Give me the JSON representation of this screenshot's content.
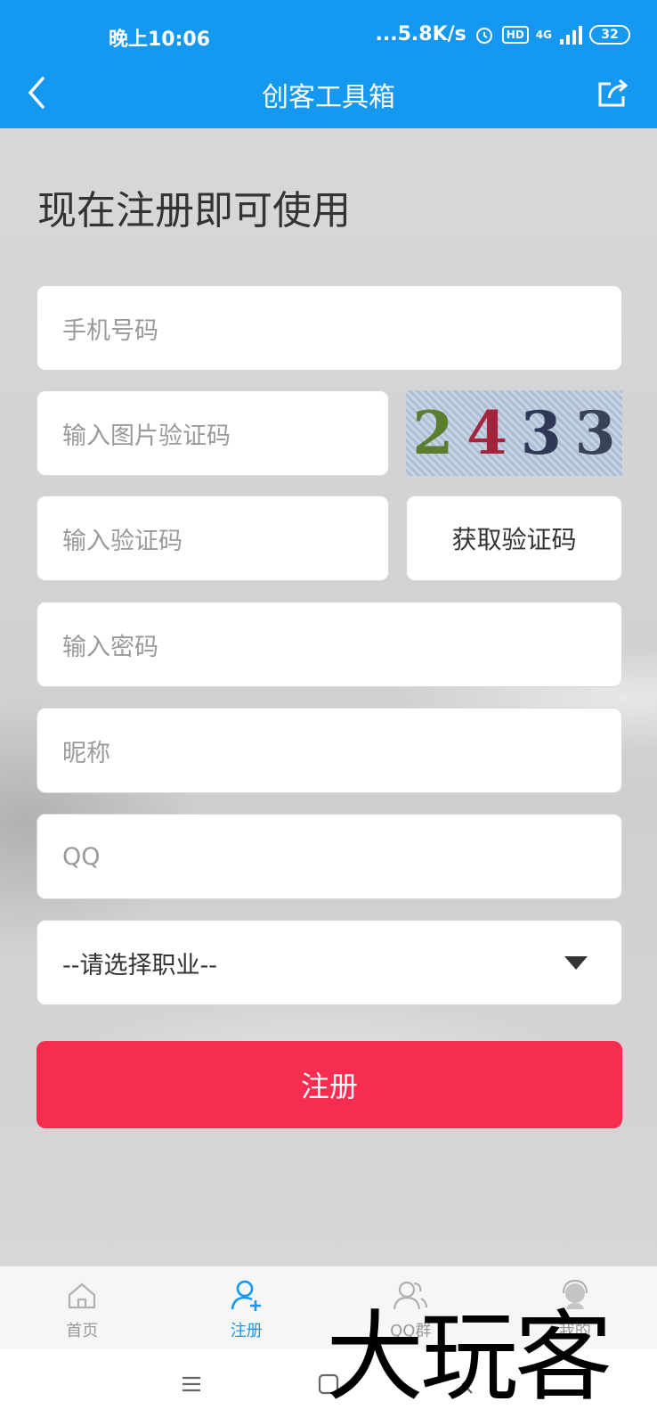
{
  "status_bar": {
    "time": "晚上10:06",
    "network_speed": "...5.8K/s",
    "hd_label": "HD",
    "network_label": "4G",
    "battery": "32"
  },
  "header": {
    "title": "创客工具箱",
    "back_icon": "chevron-left-icon",
    "share_icon": "share-icon",
    "bg_color": "#1598f0"
  },
  "form": {
    "heading": "现在注册即可使用",
    "phone_placeholder": "手机号码",
    "captcha_placeholder": "输入图片验证码",
    "captcha_digits": [
      "2",
      "4",
      "3",
      "3"
    ],
    "captcha_colors": [
      "#5b7d2e",
      "#a4243b",
      "#2e3a55",
      "#3a4258"
    ],
    "code_placeholder": "输入验证码",
    "get_code_label": "获取验证码",
    "password_placeholder": "输入密码",
    "nickname_placeholder": "昵称",
    "qq_placeholder": "QQ",
    "occupation_select": "--请选择职业--",
    "submit_label": "注册",
    "submit_color": "#f62d50"
  },
  "tabbar": {
    "items": [
      {
        "label": "首页",
        "icon": "home-icon",
        "active": false
      },
      {
        "label": "注册",
        "icon": "add-user-icon",
        "active": true
      },
      {
        "label": "QQ群",
        "icon": "group-icon",
        "active": false
      },
      {
        "label": "我的",
        "icon": "support-agent-icon",
        "active": false
      }
    ]
  },
  "watermark": "大玩客"
}
